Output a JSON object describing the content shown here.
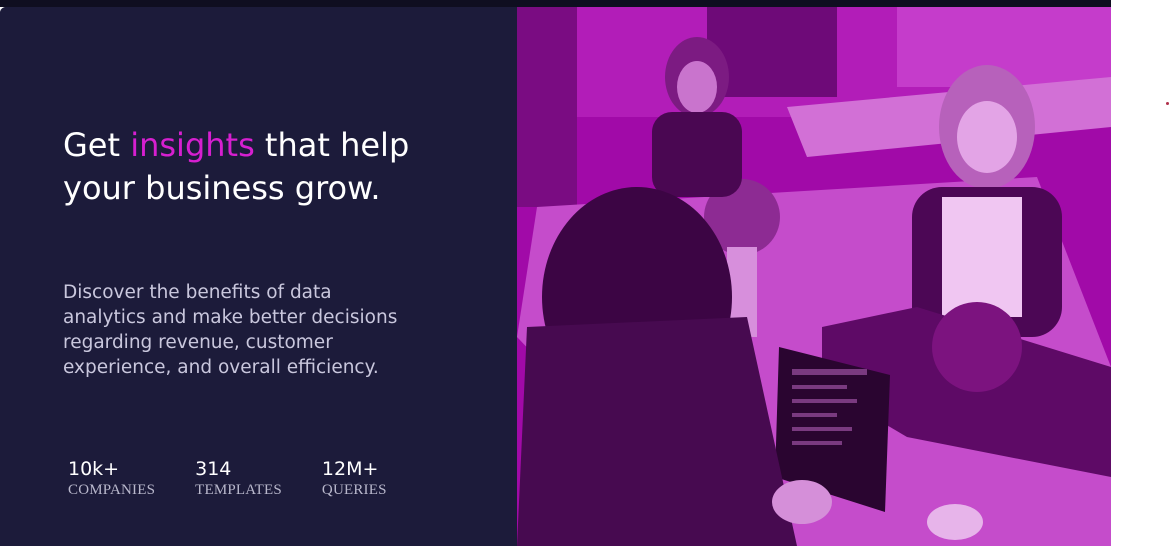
{
  "hero": {
    "headline_pre": "Get ",
    "headline_accent": "insights",
    "headline_post": " that help your business grow.",
    "description": "Discover the benefits of data analytics and make better decisions regarding revenue, customer experience, and overall efficiency.",
    "accent_color": "#d61fd0",
    "background_color": "#1c1b3a"
  },
  "stats": [
    {
      "value": "10k+",
      "label": "COMPANIES"
    },
    {
      "value": "314",
      "label": "TEMPLATES"
    },
    {
      "value": "12M+",
      "label": "QUERIES"
    }
  ],
  "image": {
    "icon": "office-team-photo",
    "tint_color": "#a10aa8"
  }
}
